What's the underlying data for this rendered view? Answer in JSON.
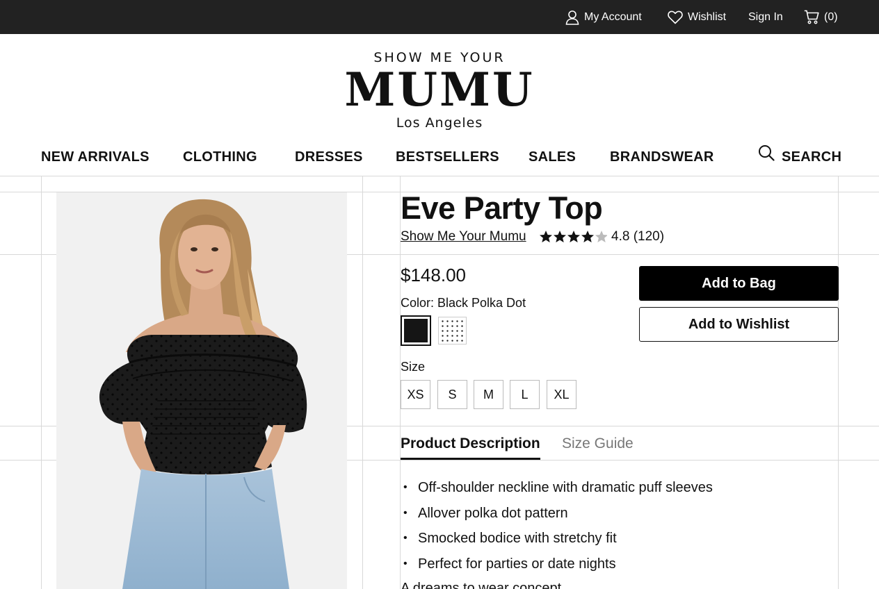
{
  "topbar": {
    "account": "My Account",
    "wishlist": "Wishlist",
    "signin": "Sign In",
    "cart": "(0)"
  },
  "logo": {
    "line1": "SHOW ME YOUR",
    "line2": "MUMU",
    "line3": "Los Angeles"
  },
  "nav": {
    "items": [
      "NEW ARRIVALS",
      "CLOTHING",
      "DRESSES",
      "BESTSELLERS",
      "SALES",
      "BRANDSWEAR"
    ],
    "search": "SEARCH"
  },
  "product": {
    "title": "Eve Party Top",
    "brand": "Show Me Your Mumu",
    "rating_value": 4.8,
    "rating_text": "4.8 (120)",
    "price": "$148.00",
    "color_label": "Color: Black Polka Dot",
    "colors": [
      "Black Polka Dot",
      "White Polka Dot"
    ],
    "selected_color": "Black Polka Dot",
    "size_label": "Size",
    "sizes": [
      "XS",
      "S",
      "M",
      "L",
      "XL"
    ],
    "add_to_bag": "Add to Bag",
    "add_to_wishlist": "Add to Wishlist"
  },
  "tabs": {
    "description": "Product Description",
    "size_guide": "Size Guide",
    "active": "Product Description"
  },
  "description": {
    "bullets": [
      "Off-shoulder neckline with dramatic puff sleeves",
      "Allover polka dot pattern",
      "Smocked bodice with stretchy fit",
      "Perfect for parties or date nights"
    ],
    "partial_line": "A dreams to wear concept"
  },
  "colors": {
    "topbar_bg": "#222222",
    "primary_button": "#000000",
    "grid_line": "#d8d8d8"
  },
  "icons": [
    "user-icon",
    "heart-icon",
    "cart-icon",
    "search-icon",
    "star-icon"
  ]
}
